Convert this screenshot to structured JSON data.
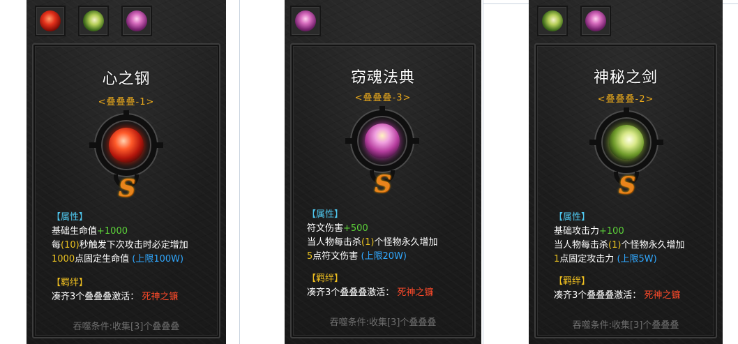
{
  "panels": [
    {
      "tabs": [
        {
          "icon": "red-heart-crystal-icon"
        },
        {
          "icon": "sword-icon"
        },
        {
          "icon": "spellbook-icon"
        }
      ],
      "title": "心之钢",
      "stack_label": "<叠叠叠-1>",
      "emblem_icon": "red-heart-crystal-icon",
      "rank": "S",
      "attr_header": "【属性】",
      "line1_label": "基础生命值",
      "line1_value": "+1000",
      "line2_a": "每",
      "line2_b": "(10)",
      "line2_c": "秒触发下次攻击时必定增加",
      "line3_a": "1000",
      "line3_b": "点固定生命值",
      "line3_c": "(上限100W)",
      "bond_header": "【羁绊】",
      "bond_text": "凑齐3个叠叠叠激活：",
      "bond_value": "死神之镰",
      "footer": "吞噬条件:收集[3]个叠叠叠"
    },
    {
      "tabs": [
        {
          "icon": "spellbook-icon"
        }
      ],
      "title": "窃魂法典",
      "stack_label": "<叠叠叠-3>",
      "emblem_icon": "spellbook-icon",
      "rank": "S",
      "attr_header": "【属性】",
      "line1_label": "符文伤害",
      "line1_value": "+500",
      "line2_a": "当人物每击杀",
      "line2_b": "(1)",
      "line2_c": "个怪物永久增加",
      "line3_a": "5",
      "line3_b": "点符文伤害",
      "line3_c": "(上限20W)",
      "bond_header": "【羁绊】",
      "bond_text": "凑齐3个叠叠叠激活：",
      "bond_value": "死神之镰",
      "footer": "吞噬条件:收集[3]个叠叠叠"
    },
    {
      "tabs": [
        {
          "icon": "sword-icon"
        },
        {
          "icon": "spellbook-icon"
        }
      ],
      "title": "神秘之剑",
      "stack_label": "<叠叠叠-2>",
      "emblem_icon": "sword-icon",
      "rank": "S",
      "attr_header": "【属性】",
      "line1_label": "基础攻击力",
      "line1_value": "+100",
      "line2_a": "当人物每击杀",
      "line2_b": "(1)",
      "line2_c": "个怪物永久增加",
      "line3_a": "1",
      "line3_b": "点固定攻击力",
      "line3_c": "(上限5W)",
      "bond_header": "【羁绊】",
      "bond_text": "凑齐3个叠叠叠激活：",
      "bond_value": "死神之镰",
      "footer": "吞噬条件:收集[3]个叠叠叠"
    }
  ]
}
